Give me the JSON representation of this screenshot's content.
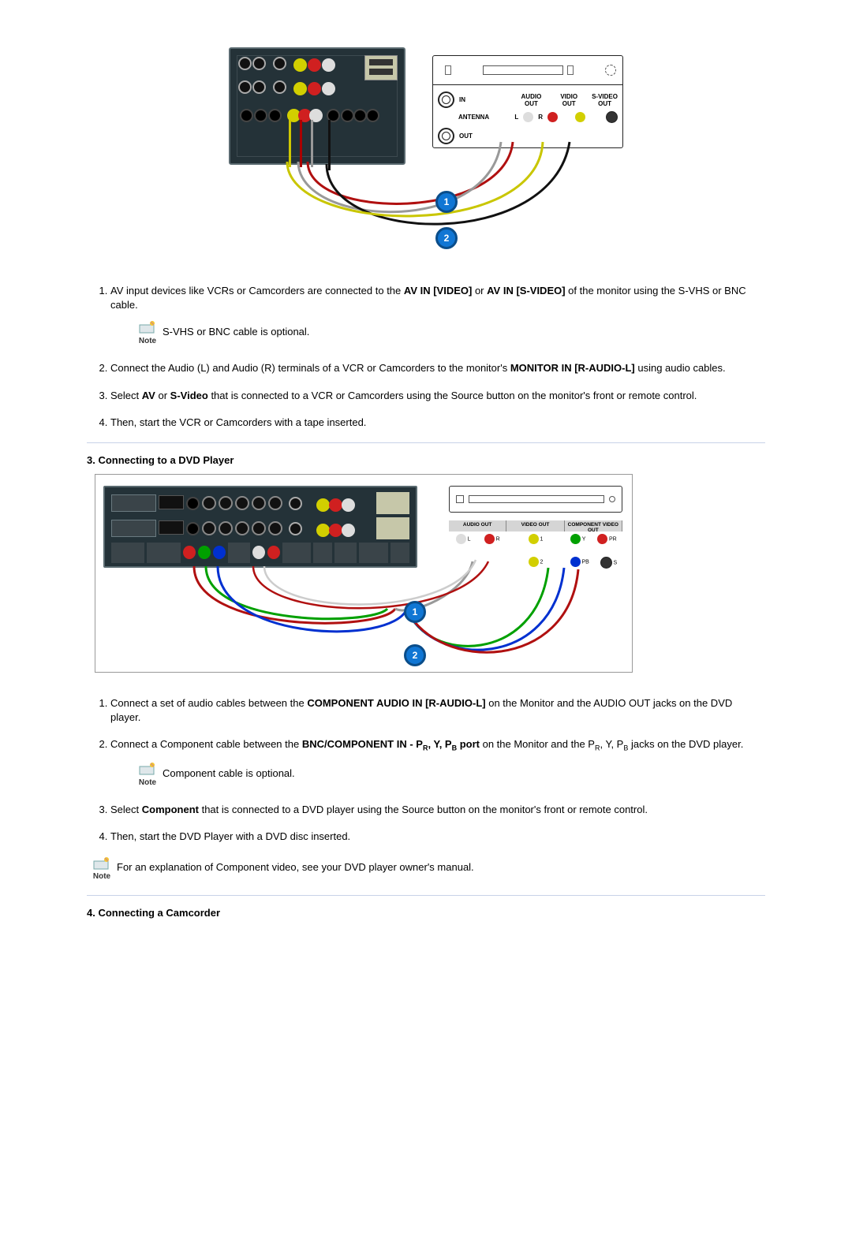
{
  "section_vcr": {
    "diagram_labels": {
      "in": "IN",
      "out": "OUT",
      "antenna": "ANTENNA",
      "audio_out": "AUDIO\nOUT",
      "l": "L",
      "r": "R",
      "video_out": "VIDIO\nOUT",
      "svideo_out": "S-VIDEO\nOUT",
      "marker1": "1",
      "marker2": "2"
    },
    "steps": [
      {
        "pre": "AV input devices like VCRs or Camcorders are connected to the ",
        "bold1": "AV IN [VIDEO]",
        "mid1": " or ",
        "bold2": "AV IN [S-VIDEO]",
        "post": " of the monitor using the S-VHS or BNC cable."
      },
      {
        "pre": "Connect the Audio (L) and Audio (R) terminals of a VCR or Camcorders to the monitor's ",
        "bold1": "MONITOR IN [R-AUDIO-L]",
        "post": " using audio cables."
      },
      {
        "pre": "Select ",
        "bold1": "AV",
        "mid1": " or ",
        "bold2": "S-Video",
        "post": " that is connected to a VCR or Camcorders using the Source button on the monitor's front or remote control."
      },
      {
        "plain": "Then, start the VCR or Camcorders with a tape inserted."
      }
    ],
    "note1": "S-VHS or BNC cable is optional.",
    "note_label": "Note"
  },
  "section_dvd": {
    "heading": "3. Connecting to a DVD Player",
    "diagram_labels": {
      "audio_out": "AUDIO OUT",
      "video_out": "VIDEO OUT",
      "component_video_out": "COMPONENT VIDEO OUT",
      "l": "L",
      "r": "R",
      "one": "1",
      "two": "2",
      "y": "Y",
      "pb": "PB",
      "pr": "PR",
      "s": "S",
      "marker1": "1",
      "marker2": "2"
    },
    "steps": [
      {
        "pre": "Connect a set of audio cables between the ",
        "bold1": "COMPONENT AUDIO IN [R-AUDIO-L]",
        "post": " on the Monitor and the AUDIO OUT jacks on the DVD player."
      },
      {
        "pre": "Connect a Component cable between the ",
        "bold1": "BNC/COMPONENT IN - PR, Y, PB port",
        "post_html": " on the Monitor and the PR, Y, PB jacks on the DVD player."
      },
      {
        "pre": "Select ",
        "bold1": "Component",
        "post": " that is connected to a DVD player using the Source button on the monitor's front or remote control."
      },
      {
        "plain": "Then, start the DVD Player with a DVD disc inserted."
      }
    ],
    "note_mid": "Component cable is optional.",
    "note_end": "For an explanation of Component video, see your DVD player owner's manual.",
    "note_label": "Note"
  },
  "section_cam": {
    "heading": "4. Connecting a Camcorder"
  }
}
